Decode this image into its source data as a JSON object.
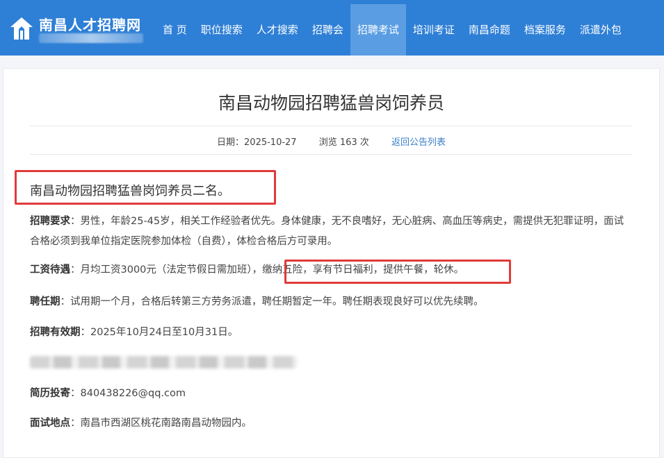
{
  "site": {
    "title": "南昌人才招聘网"
  },
  "nav": {
    "items": [
      {
        "label": "首 页"
      },
      {
        "label": "职位搜索"
      },
      {
        "label": "人才搜索"
      },
      {
        "label": "招聘会"
      },
      {
        "label": "招聘考试",
        "active": true
      },
      {
        "label": "培训考证"
      },
      {
        "label": "南昌命题"
      },
      {
        "label": "档案服务"
      },
      {
        "label": "派遣外包"
      }
    ]
  },
  "article": {
    "title": "南昌动物园招聘猛兽岗饲养员",
    "date": "日期：2025-10-27",
    "views": "浏览 163 次",
    "back_link": "返回公告列表",
    "intro": "南昌动物园招聘猛兽岗饲养员二名。",
    "requirements_label": "招聘要求",
    "requirements_text": "：男性，年龄25-45岁，相关工作经验者优先。身体健康，无不良嗜好，无心脏病、高血压等病史，需提供无犯罪证明，面试合格必须到我单位指定医院参加体检（自费），体检合格后方可录用。",
    "salary_label": "工资待遇",
    "salary_text": "：月均工资3000元（法定节假日需加班），缴纳五险，享有节日福利，提供午餐，轮休。",
    "term_label": "聘任期",
    "term_text": "：试用期一个月，合格后转第三方劳务派遣，聘任期暂定一年。聘任期表现良好可以优先续聘。",
    "validity_label": "招聘有效期",
    "validity_text": "：2025年10月24日至10月31日。",
    "resume_label": "简历投寄",
    "resume_text": "：840438226@qq.com",
    "location_label": "面试地点",
    "location_text": "：南昌市西湖区桃花南路南昌动物园内。"
  },
  "colors": {
    "header": "#2e7fd6",
    "nav_active": "#5a9de3",
    "highlight_border": "#e03a3a",
    "link": "#3a7fc9"
  }
}
